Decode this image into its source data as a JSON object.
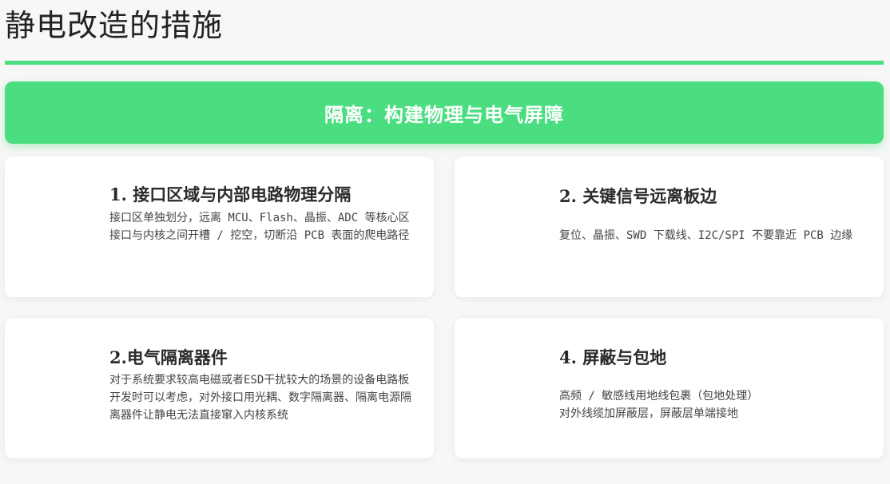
{
  "page": {
    "title": "静电改造的措施"
  },
  "colors": {
    "accent": "#4ade80",
    "card_background": "#ffffff",
    "page_background": "#f6f7f6"
  },
  "banner": {
    "text": "隔离：构建物理与电气屏障"
  },
  "cards": [
    {
      "title": "1. 接口区域与内部电路物理分隔",
      "lines": [
        "接口区单独划分，远离 MCU、Flash、晶振、ADC 等核心区",
        "接口与内核之间开槽 / 挖空，切断沿 PCB 表面的爬电路径"
      ]
    },
    {
      "title": "2. 关键信号远离板边",
      "lines": [
        "复位、晶振、SWD 下载线、I2C/SPI 不要靠近 PCB 边缘"
      ]
    },
    {
      "title": "2.电气隔离器件",
      "lines": [
        "对于系统要求较高电磁或者ESD干扰较大的场景的设备电路板开发时可以考虑，对外接口用光耦、数字隔离器、隔离电源隔离器件让静电无法直接窜入内核系统"
      ]
    },
    {
      "title": "4. 屏蔽与包地",
      "lines": [
        "高频 / 敏感线用地线包裹（包地处理）",
        "对外线缆加屏蔽层，屏蔽层单端接地"
      ]
    }
  ]
}
